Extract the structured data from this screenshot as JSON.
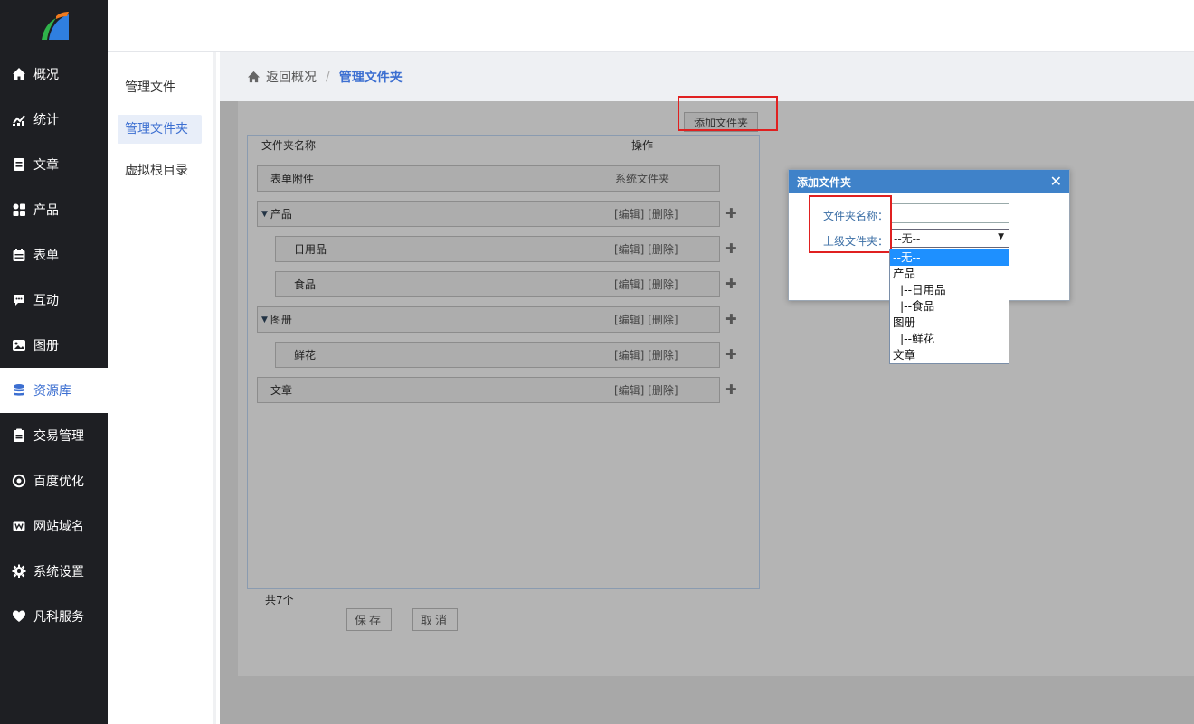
{
  "nav": {
    "items": [
      {
        "label": "概况",
        "icon": "home-icon"
      },
      {
        "label": "统计",
        "icon": "chart-icon"
      },
      {
        "label": "文章",
        "icon": "article-icon"
      },
      {
        "label": "产品",
        "icon": "grid-icon"
      },
      {
        "label": "表单",
        "icon": "calendar-icon"
      },
      {
        "label": "互动",
        "icon": "chat-icon"
      },
      {
        "label": "图册",
        "icon": "image-icon"
      },
      {
        "label": "资源库",
        "icon": "database-icon",
        "active": true
      },
      {
        "label": "交易管理",
        "icon": "clipboard-icon"
      },
      {
        "label": "百度优化",
        "icon": "target-icon"
      },
      {
        "label": "网站域名",
        "icon": "w-badge-icon"
      },
      {
        "label": "系统设置",
        "icon": "gear-icon"
      },
      {
        "label": "凡科服务",
        "icon": "heart-icon"
      }
    ]
  },
  "subnav": {
    "items": [
      "管理文件",
      "管理文件夹",
      "虚拟根目录"
    ],
    "active": "管理文件夹"
  },
  "breadcrumb": {
    "home": "返回概况",
    "separator": "/",
    "current": "管理文件夹"
  },
  "toolbar": {
    "add_folder": "添加文件夹"
  },
  "table": {
    "col_name": "文件夹名称",
    "col_ops": "操作",
    "rows": [
      {
        "name": "表单附件",
        "ops": "系统文件夹"
      },
      {
        "name": "产品",
        "ops": "[编辑] [删除]"
      },
      {
        "name": "日用品",
        "ops": "[编辑] [删除]"
      },
      {
        "name": "食品",
        "ops": "[编辑] [删除]"
      },
      {
        "name": "图册",
        "ops": "[编辑] [删除]"
      },
      {
        "name": "鲜花",
        "ops": "[编辑] [删除]"
      },
      {
        "name": "文章",
        "ops": "[编辑] [删除]"
      }
    ],
    "count": "共7个"
  },
  "buttons": {
    "save": "保存",
    "cancel": "取消"
  },
  "dialog": {
    "title": "添加文件夹",
    "close": "✕",
    "name_label": "文件夹名称：",
    "name_value": "",
    "parent_label": "上级文件夹：",
    "parent_selected": "--无--",
    "options": [
      "--无--",
      "产品",
      "  |--日用品",
      "  |--食品",
      "图册",
      "  |--鲜花",
      "文章"
    ]
  },
  "colors": {
    "sidebar_bg": "#1e1f23",
    "accent": "#3c6fd1",
    "dialog_header": "#3f82c9",
    "highlight": "#e02020",
    "option_selected": "#1e90ff"
  }
}
